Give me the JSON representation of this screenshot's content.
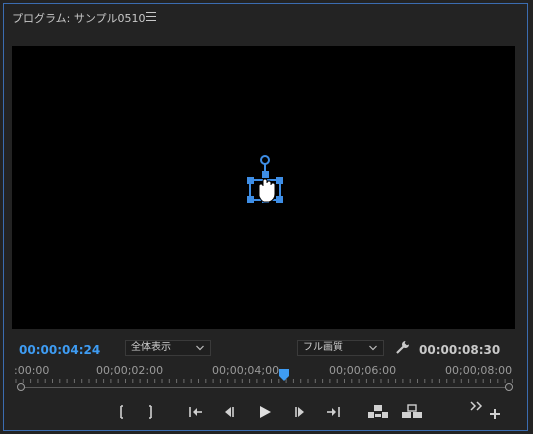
{
  "panel": {
    "title": "プログラム: サンプル0510",
    "menu_icon": "hamburger-menu-icon"
  },
  "viewer": {
    "gizmo_icon": "transform-anchor-icon",
    "cursor_icon": "hand-cursor-icon"
  },
  "status": {
    "current_timecode": "00:00:04:24",
    "zoom_value": "全体表示",
    "quality_value": "フル画質",
    "settings_icon": "wrench-icon",
    "duration_timecode": "00:00:08:30"
  },
  "ruler": {
    "labels": [
      ":00:00",
      "00;00;02:00",
      "00;00;04;00",
      "00;00;06:00",
      "00;00;08:00"
    ]
  },
  "controls": [
    {
      "name": "mark-in-button",
      "icon": "mark-in-icon"
    },
    {
      "name": "mark-out-button",
      "icon": "mark-out-icon"
    },
    {
      "name": "go-to-in-button",
      "icon": "go-to-in-icon"
    },
    {
      "name": "step-back-button",
      "icon": "step-back-icon"
    },
    {
      "name": "play-button",
      "icon": "play-icon"
    },
    {
      "name": "step-forward-button",
      "icon": "step-forward-icon"
    },
    {
      "name": "go-to-out-button",
      "icon": "go-to-out-icon"
    },
    {
      "name": "lift-button",
      "icon": "lift-icon"
    },
    {
      "name": "extract-button",
      "icon": "extract-icon"
    },
    {
      "name": "more-controls-button",
      "icon": "double-chevron-icon"
    },
    {
      "name": "button-editor-button",
      "icon": "plus-icon"
    }
  ],
  "colors": {
    "accent": "#3e9cf3",
    "panel_border": "#3b6cb0",
    "background": "#232323"
  }
}
